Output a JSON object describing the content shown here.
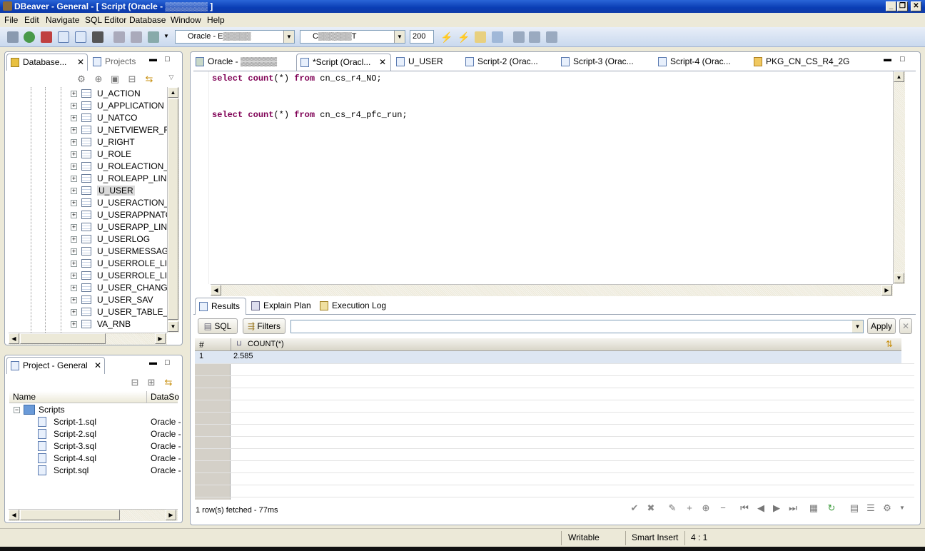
{
  "window": {
    "title": "DBeaver - General - [ Script (Oracle - ▒▒▒▒▒▒▒ ]"
  },
  "menu": [
    "File",
    "Edit",
    "Navigate",
    "SQL Editor",
    "Database",
    "Window",
    "Help"
  ],
  "toolbar": {
    "connection": "Oracle - E▒▒▒▒▒",
    "schema": "C▒▒▒▒▒▒T",
    "max_rows": "200"
  },
  "navigator": {
    "tab_label": "Database...",
    "projects_tab": "Projects",
    "items": [
      "U_ACTION",
      "U_APPLICATION",
      "U_NATCO",
      "U_NETVIEWER_FAV",
      "U_RIGHT",
      "U_ROLE",
      "U_ROLEACTION_LINK",
      "U_ROLEAPP_LINK",
      "U_USER",
      "U_USERACTION_LINK",
      "U_USERAPPNATCO",
      "U_USERAPP_LINK",
      "U_USERLOG",
      "U_USERMESSAGING",
      "U_USERROLE_LINK",
      "U_USERROLE_LINK",
      "U_USER_CHANGES",
      "U_USER_SAV",
      "U_USER_TABLE_FILTER",
      "VA_RNB"
    ],
    "selected": "U_USER"
  },
  "project": {
    "tab_label": "Project - General",
    "col_name": "Name",
    "col_datasource": "DataSo",
    "root": "Scripts",
    "scripts": [
      {
        "name": "Script-1.sql",
        "ds": "Oracle -"
      },
      {
        "name": "Script-2.sql",
        "ds": "Oracle -"
      },
      {
        "name": "Script-3.sql",
        "ds": "Oracle -"
      },
      {
        "name": "Script-4.sql",
        "ds": "Oracle -"
      },
      {
        "name": "Script.sql",
        "ds": "Oracle -"
      }
    ]
  },
  "editor_tabs": [
    "Oracle - ▒▒▒▒▒▒",
    "*Script (Oracl...",
    "U_USER",
    "Script-2 (Orac...",
    "Script-3 (Orac...",
    "Script-4 (Orac...",
    "PKG_CN_CS_R4_2G"
  ],
  "sql": {
    "line1": {
      "kw1": "select",
      "kw2": "count",
      "mid": "(*)",
      "kw3": "from",
      "table": "cn_cs_r4_NO;"
    },
    "line2": {
      "kw1": "select",
      "kw2": "count",
      "mid": "(*)",
      "kw3": "from",
      "table": "cn_cs_r4_pfc_run;"
    }
  },
  "results": {
    "tabs": [
      "Results",
      "Explain Plan",
      "Execution Log"
    ],
    "sql_btn": "SQL",
    "filters_btn": "Filters",
    "apply_btn": "Apply",
    "col_num": "#",
    "col_count": "COUNT(*)",
    "row_num": "1",
    "row_value": "2.585",
    "status": "1 row(s) fetched - 77ms"
  },
  "statusbar": {
    "mode": "Writable",
    "insert": "Smart Insert",
    "position": "4 : 1"
  }
}
